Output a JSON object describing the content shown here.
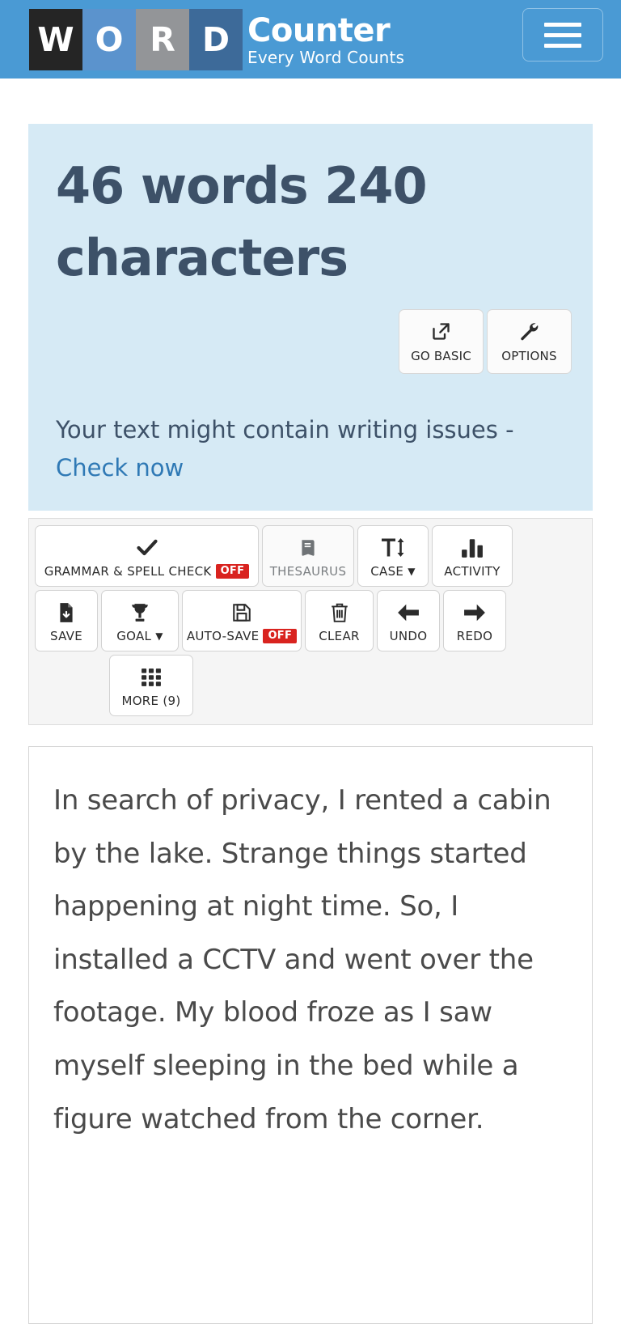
{
  "header": {
    "logo_blocks": [
      {
        "letter": "W",
        "color": "#252525"
      },
      {
        "letter": "O",
        "color": "#5b93cd"
      },
      {
        "letter": "R",
        "color": "#939598"
      },
      {
        "letter": "D",
        "color": "#3d6a99"
      }
    ],
    "brand_main": "Counter",
    "brand_sub": "Every Word Counts",
    "background": "#4a9ad4",
    "menu_icon": "hamburger-icon"
  },
  "count_panel": {
    "heading": "46 words 240 characters",
    "word_count": 46,
    "character_count": 240,
    "background": "#d6eaf5",
    "text_color": "#3d5168",
    "actions": [
      {
        "label": "GO BASIC",
        "icon": "external-link-icon"
      },
      {
        "label": "OPTIONS",
        "icon": "wrench-icon"
      }
    ],
    "issues_text": "Your text might contain writing issues",
    "issues_dash": "-",
    "issues_link": "Check now",
    "link_color": "#2f79b5"
  },
  "toolbar": {
    "rows": [
      [
        {
          "label": "GRAMMAR & SPELL CHECK",
          "icon": "check-icon",
          "badge": "OFF",
          "badge_color": "#d9231f"
        },
        {
          "label": "THESAURUS",
          "icon": "book-icon",
          "muted": true
        },
        {
          "label": "CASE",
          "icon": "text-height-icon",
          "caret": "▼"
        },
        {
          "label": "ACTIVITY",
          "icon": "bar-chart-icon"
        }
      ],
      [
        {
          "label": "SAVE",
          "icon": "file-download-icon"
        },
        {
          "label": "GOAL",
          "icon": "trophy-icon",
          "caret": "▼"
        },
        {
          "label": "AUTO-SAVE",
          "icon": "floppy-disk-icon",
          "badge": "OFF",
          "badge_color": "#d9231f"
        },
        {
          "label": "CLEAR",
          "icon": "trash-icon"
        },
        {
          "label": "UNDO",
          "icon": "arrow-left-icon"
        },
        {
          "label": "REDO",
          "icon": "arrow-right-icon"
        }
      ],
      [
        {
          "label": "MORE (9)",
          "icon": "grid-icon"
        }
      ]
    ]
  },
  "editor": {
    "content": "In search of privacy, I rented a cabin by the lake. Strange things started happening at night time. So, I installed a CCTV and went over the footage. My blood froze as I saw myself sleeping in the bed while a figure watched from the corner."
  }
}
